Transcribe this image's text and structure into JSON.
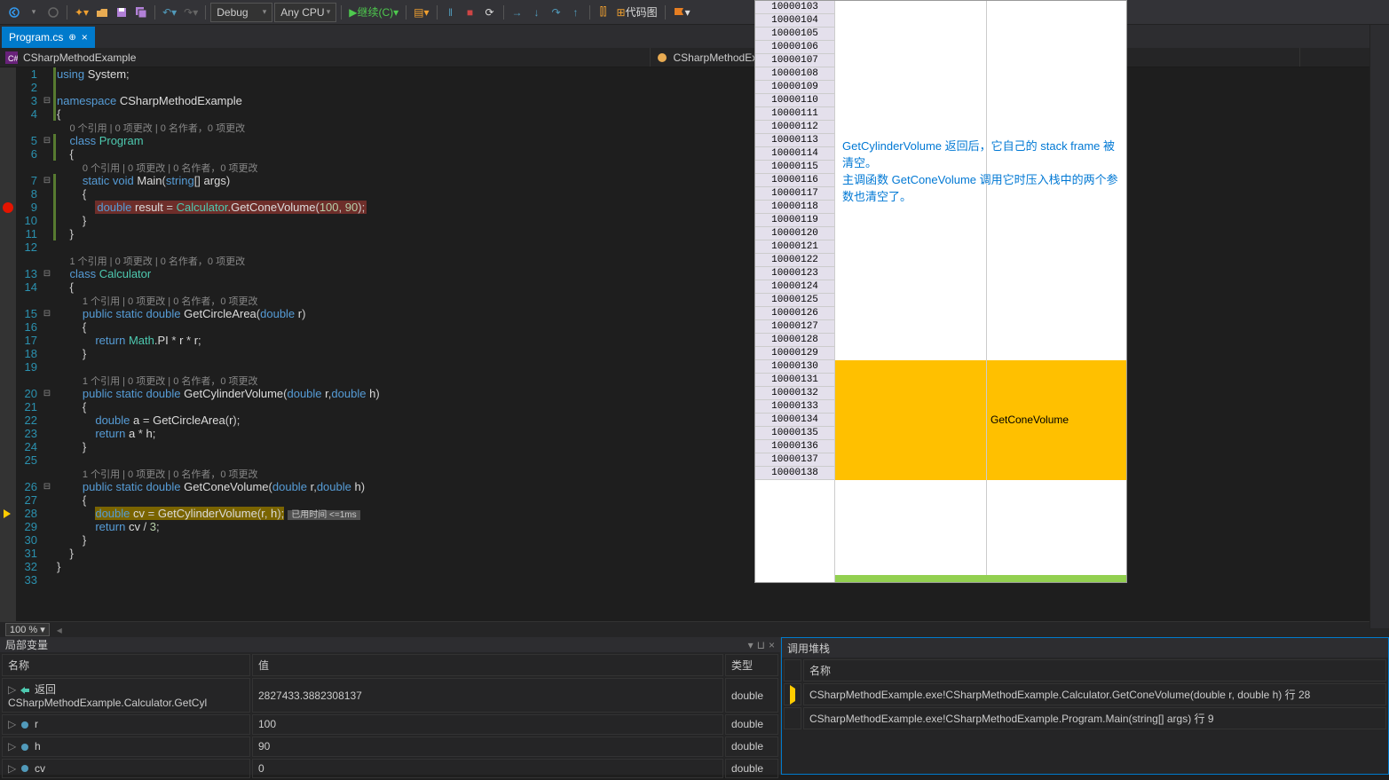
{
  "toolbar": {
    "config": "Debug",
    "platform": "Any CPU",
    "run": "继续(C)",
    "codemap": "代码图"
  },
  "tab": {
    "name": "Program.cs"
  },
  "nav": {
    "scope": "CSharpMethodExample",
    "member": "CSharpMethodExample.Calculator"
  },
  "zoom": "100 %",
  "code": {
    "ref0": "0 个引用 | 0 项更改 | 0 名作者，0 项更改",
    "ref1": "1 个引用 | 0 项更改 | 0 名作者，0 项更改",
    "timing": "已用时间 <=1ms"
  },
  "memory": {
    "start": 10000103,
    "count": 36,
    "annotation": "GetCylinderVolume 返回后，它自己的 stack frame 被清空。\n主调函数 GetConeVolume 调用它时压入栈中的两个参数也清空了。",
    "label": "GetConeVolume",
    "fill_start": 10000130,
    "label_row": 10000134
  },
  "locals": {
    "title": "局部变量",
    "cols": {
      "name": "名称",
      "value": "值",
      "type": "类型"
    },
    "rows": [
      {
        "icon": "return",
        "name": "返回 CSharpMethodExample.Calculator.GetCyl",
        "value": "2827433.3882308137",
        "type": "double"
      },
      {
        "icon": "param",
        "name": "r",
        "value": "100",
        "type": "double"
      },
      {
        "icon": "param",
        "name": "h",
        "value": "90",
        "type": "double"
      },
      {
        "icon": "local",
        "name": "cv",
        "value": "0",
        "type": "double"
      }
    ]
  },
  "callstack": {
    "title": "调用堆栈",
    "col": "名称",
    "frames": [
      {
        "current": true,
        "text": "CSharpMethodExample.exe!CSharpMethodExample.Calculator.GetConeVolume(double r, double h) 行 28"
      },
      {
        "current": false,
        "text": "CSharpMethodExample.exe!CSharpMethodExample.Program.Main(string[] args) 行 9"
      }
    ]
  }
}
